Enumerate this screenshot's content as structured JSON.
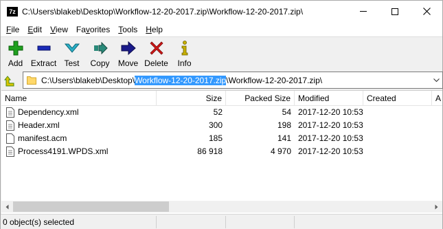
{
  "window": {
    "title": "C:\\Users\\blakeb\\Desktop\\Workflow-12-20-2017.zip\\Workflow-12-20-2017.zip\\",
    "app_icon_text": "7z"
  },
  "menu": [
    {
      "label": "File",
      "ul": "F",
      "rest": "ile"
    },
    {
      "label": "Edit",
      "ul": "E",
      "rest": "dit"
    },
    {
      "label": "View",
      "ul": "V",
      "rest": "iew"
    },
    {
      "label": "Favorites",
      "ul": "F",
      "rest": "avorites",
      "prefix": "Fa",
      "ul2": "v",
      "rest2": "orites"
    },
    {
      "label": "Tools",
      "ul": "T",
      "rest": "ools"
    },
    {
      "label": "Help",
      "ul": "H",
      "rest": "elp"
    }
  ],
  "toolbar": {
    "add": "Add",
    "extract": "Extract",
    "test": "Test",
    "copy": "Copy",
    "move": "Move",
    "delete": "Delete",
    "info": "Info"
  },
  "address": {
    "prefix": "C:\\Users\\blakeb\\Desktop\\",
    "selected": "Workflow-12-20-2017.zip",
    "suffix": "\\Workflow-12-20-2017.zip\\"
  },
  "columns": {
    "name": "Name",
    "size": "Size",
    "packed": "Packed Size",
    "modified": "Modified",
    "created": "Created",
    "next": "A"
  },
  "files": [
    {
      "name": "Dependency.xml",
      "size": "52",
      "packed": "54",
      "modified": "2017-12-20 10:53"
    },
    {
      "name": "Header.xml",
      "size": "300",
      "packed": "198",
      "modified": "2017-12-20 10:53"
    },
    {
      "name": "manifest.acm",
      "size": "185",
      "packed": "141",
      "modified": "2017-12-20 10:53"
    },
    {
      "name": "Process4191.WPDS.xml",
      "size": "86 918",
      "packed": "4 970",
      "modified": "2017-12-20 10:53"
    }
  ],
  "status": {
    "selection": "0 object(s) selected"
  },
  "colors": {
    "add": "#1fa01f",
    "extract": "#1a2bb8",
    "test": "#2ab0c8",
    "copy": "#2a8a7a",
    "move": "#1a1a8a",
    "delete": "#d01818",
    "info": "#c8b000",
    "selection": "#3399ff"
  }
}
